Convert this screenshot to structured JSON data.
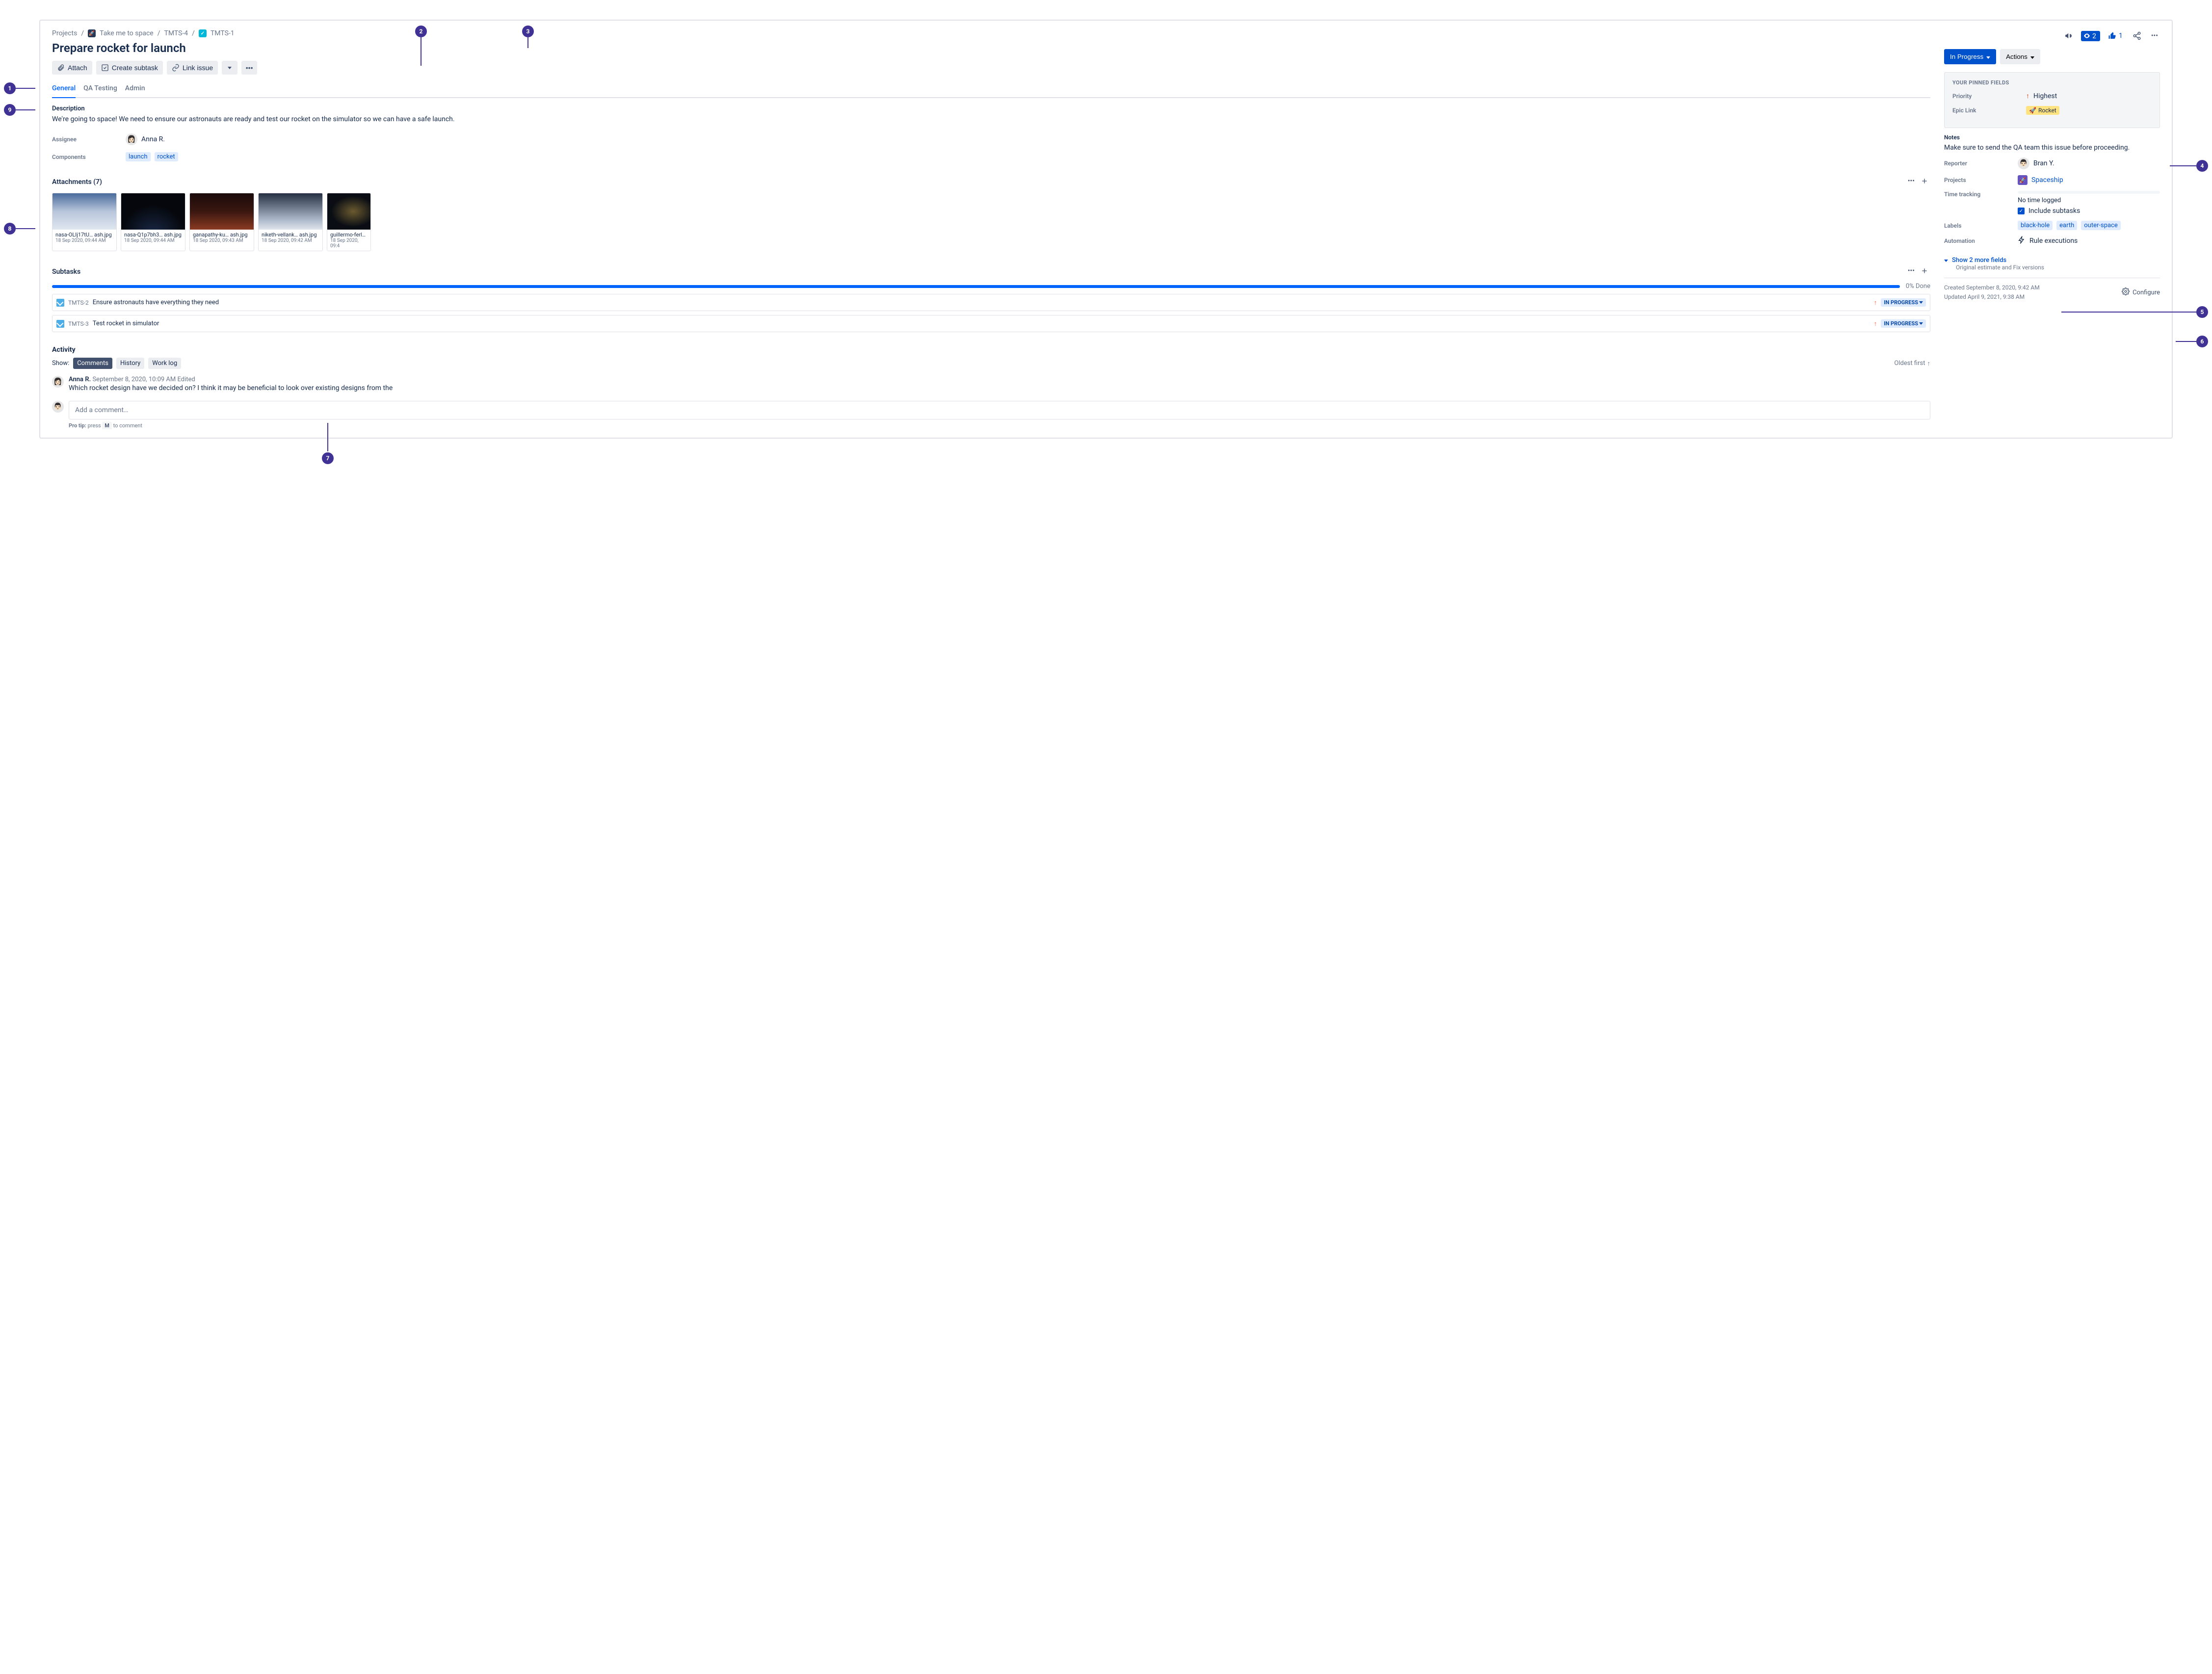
{
  "breadcrumbs": {
    "root": "Projects",
    "project": "Take me to space",
    "parent_key": "TMTS-4",
    "issue_key": "TMTS-1"
  },
  "title": "Prepare rocket for launch",
  "quickbar": {
    "attach": "Attach",
    "create_subtask": "Create subtask",
    "link_issue": "Link issue"
  },
  "tabs": {
    "general": "General",
    "qa": "QA Testing",
    "admin": "Admin"
  },
  "description": {
    "label": "Description",
    "text": "We're going to space! We need to ensure our astronauts are ready and test our rocket on the simulator so we can have a safe launch."
  },
  "assignee": {
    "label": "Assignee",
    "name": "Anna R.",
    "avatar_emoji": "👩🏻"
  },
  "components": {
    "label": "Components",
    "items": [
      "launch",
      "rocket"
    ]
  },
  "attachments": {
    "heading": "Attachments (7)",
    "items": [
      {
        "filename": "nasa-OLIj17tU… ash.jpg",
        "date": "18 Sep 2020, 09:44 AM"
      },
      {
        "filename": "nasa-Q1p7bh3… ash.jpg",
        "date": "18 Sep 2020, 09:44 AM"
      },
      {
        "filename": "ganapathy-ku… ash.jpg",
        "date": "18 Sep 2020, 09:43 AM"
      },
      {
        "filename": "niketh-vellank… ash.jpg",
        "date": "18 Sep 2020, 09:42 AM"
      },
      {
        "filename": "guillermo-ferl… a",
        "date": "18 Sep 2020, 09:4"
      }
    ]
  },
  "subtasks": {
    "heading": "Subtasks",
    "progress_text": "0% Done",
    "status_label": "IN PROGRESS",
    "items": [
      {
        "key": "TMTS-2",
        "summary": "Ensure astronauts have everything they need"
      },
      {
        "key": "TMTS-3",
        "summary": "Test rocket in simulator"
      }
    ]
  },
  "activity": {
    "heading": "Activity",
    "show_label": "Show:",
    "tabs": {
      "comments": "Comments",
      "history": "History",
      "worklog": "Work log"
    },
    "sort": "Oldest first",
    "comment": {
      "author": "Anna R.",
      "time": "September 8, 2020, 10:09 AM",
      "edited": "Edited",
      "text": "Which rocket design have we decided on? I think it may be beneficial to look over existing designs from the"
    },
    "input_placeholder": "Add a comment…",
    "protip_prefix": "Pro tip:",
    "protip_text1": "press",
    "protip_key": "M",
    "protip_text2": "to comment"
  },
  "top_actions": {
    "watch_count": "2",
    "vote_count": "1"
  },
  "status": {
    "in_progress": "In Progress",
    "actions": "Actions"
  },
  "pinned": {
    "header": "YOUR PINNED FIELDS",
    "priority_label": "Priority",
    "priority_value": "Highest",
    "epic_label": "Epic Link",
    "epic_value": "Rocket"
  },
  "notes": {
    "label": "Notes",
    "text": "Make sure to send the QA team this issue before proceeding."
  },
  "reporter": {
    "label": "Reporter",
    "name": "Bran Y.",
    "avatar_emoji": "👨🏻"
  },
  "projects": {
    "label": "Projects",
    "name": "Spaceship"
  },
  "time_tracking": {
    "label": "Time tracking",
    "value": "No time logged",
    "include_label": "Include subtasks"
  },
  "labels": {
    "label": "Labels",
    "items": [
      "black-hole",
      "earth",
      "outer-space"
    ]
  },
  "automation": {
    "label": "Automation",
    "value": "Rule executions"
  },
  "more_fields": {
    "link": "Show 2 more fields",
    "sub": "Original estimate and Fix versions"
  },
  "dates": {
    "created": "Created September 8, 2020, 9:42 AM",
    "updated": "Updated April 9, 2021, 9:38 AM",
    "configure": "Configure"
  },
  "annotations": {
    "1": "1",
    "2": "2",
    "3": "3",
    "4": "4",
    "5": "5",
    "6": "6",
    "7": "7",
    "8": "8",
    "9": "9"
  }
}
